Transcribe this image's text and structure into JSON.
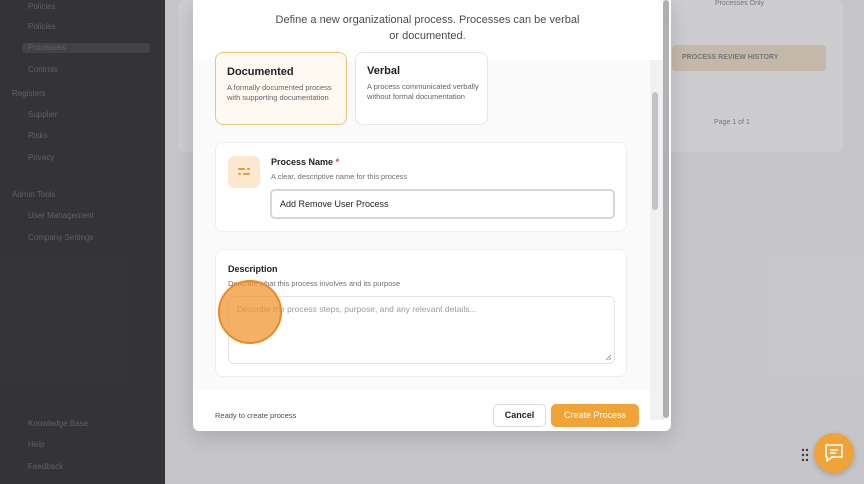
{
  "modal": {
    "subtitle_line1": "Define a new organizational process. Processes can be verbal",
    "subtitle_line2": "or documented.",
    "types": [
      {
        "title": "Documented",
        "desc": "A formally documented process with supporting documentation",
        "selected": true
      },
      {
        "title": "Verbal",
        "desc": "A process communicated verbally without formal documentation",
        "selected": false
      }
    ],
    "name_field": {
      "label": "Process Name",
      "required_mark": "*",
      "hint": "A clear, descriptive name for this process",
      "value": "Add Remove User Process"
    },
    "description_field": {
      "label": "Description",
      "hint": "Describe what this process involves and its purpose",
      "placeholder": "Describe the process steps, purpose, and any relevant details..."
    },
    "footer": {
      "status": "Ready to create process",
      "cancel_label": "Cancel",
      "create_label": "Create Process"
    }
  },
  "background": {
    "sidebar_items": [
      "Policies",
      "Processes",
      "Controls",
      "Registers",
      "Supplier",
      "Risks",
      "Privacy",
      "Admin Tools",
      "User Management",
      "Company Settings",
      "Knowledge Base",
      "Help",
      "Feedback"
    ],
    "filter_label": "Processes Only",
    "history_header": "PROCESS REVIEW HISTORY",
    "pagination": "Page 1 of 1"
  },
  "colors": {
    "accent": "#f0a437",
    "selected_border": "#f0c27a",
    "cursor": "#e88a26"
  }
}
